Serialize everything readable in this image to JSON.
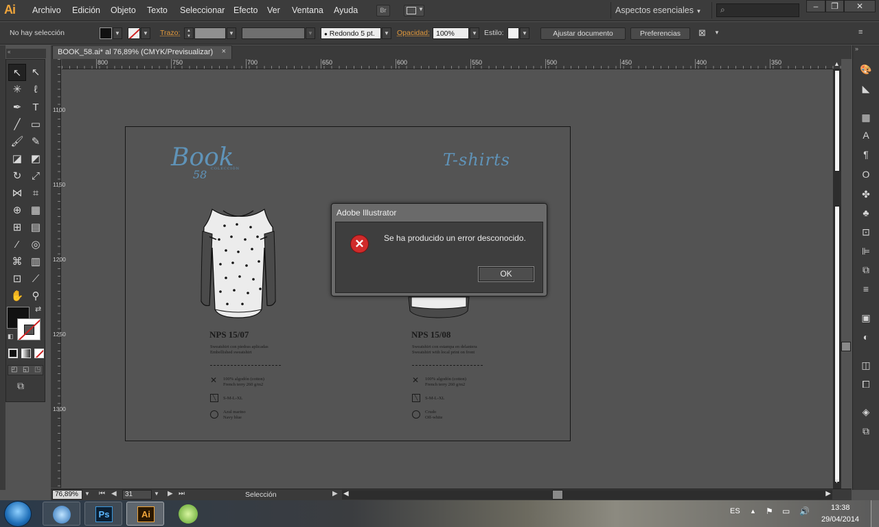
{
  "app": {
    "logo": "Ai"
  },
  "menubar": {
    "items": [
      "Archivo",
      "Edición",
      "Objeto",
      "Texto",
      "Seleccionar",
      "Efecto",
      "Ver",
      "Ventana",
      "Ayuda"
    ],
    "bridge_label": "Br",
    "workspace": "Aspectos esenciales",
    "window_buttons": [
      "–",
      "❐",
      "✕"
    ]
  },
  "control_bar": {
    "selection_status": "No hay selección",
    "stroke_label": "Trazo:",
    "brush_label": "Redondo 5 pt.",
    "opacity_label": "Opacidad:",
    "opacity_value": "100%",
    "style_label": "Estilo:",
    "fit_document_button": "Ajustar documento",
    "preferences_button": "Preferencias"
  },
  "document_tab": {
    "title": "BOOK_58.ai* al 76,89% (CMYK/Previsualizar)",
    "close": "×"
  },
  "rulers": {
    "horizontal_ticks": [
      "800",
      "750",
      "700",
      "650",
      "600",
      "550",
      "500",
      "450",
      "400",
      "350"
    ],
    "vertical_ticks": [
      "1100",
      "1150",
      "1200",
      "1250",
      "1300"
    ]
  },
  "artboard": {
    "logo_text": "Book",
    "logo_number": "58",
    "logo_sub": "COLECCIÓN",
    "section_title": "T-shirts",
    "products": [
      {
        "code": "NPS 15/07",
        "desc_es": "Sweatshirt con piedras aplicadas",
        "desc_en": "Embellished sweatshirt",
        "fabric_es": "100% algodón (cotton)",
        "fabric_en": "French terry 260 g/m2",
        "sizes": "S-M-L-XL",
        "color_es": "Azul marino",
        "color_en": "Navy blue"
      },
      {
        "code": "NPS 15/08",
        "desc_es": "Sweatshirt con estampa en delantera",
        "desc_en": "Sweatshirt with local print on front",
        "fabric_es": "100% algodón (cotton)",
        "fabric_en": "French terry 260 g/m2",
        "sizes": "S-M-L-XL",
        "color_es": "Crudo",
        "color_en": "Off-white"
      }
    ]
  },
  "dialog": {
    "title": "Adobe Illustrator",
    "message": "Se ha producido un error desconocido.",
    "ok_button": "OK"
  },
  "statusbar": {
    "zoom": "76,89%",
    "artboard_number": "31",
    "mode": "Selección"
  },
  "taskbar": {
    "language": "ES",
    "time": "13:38",
    "date": "29/04/2014",
    "apps": [
      "Ps",
      "Ai"
    ]
  },
  "colors": {
    "accent_orange": "#e49a3c",
    "ai_icon": "#f0a53b",
    "script_blue": "#5f93b8",
    "error_red": "#d02a2a"
  }
}
